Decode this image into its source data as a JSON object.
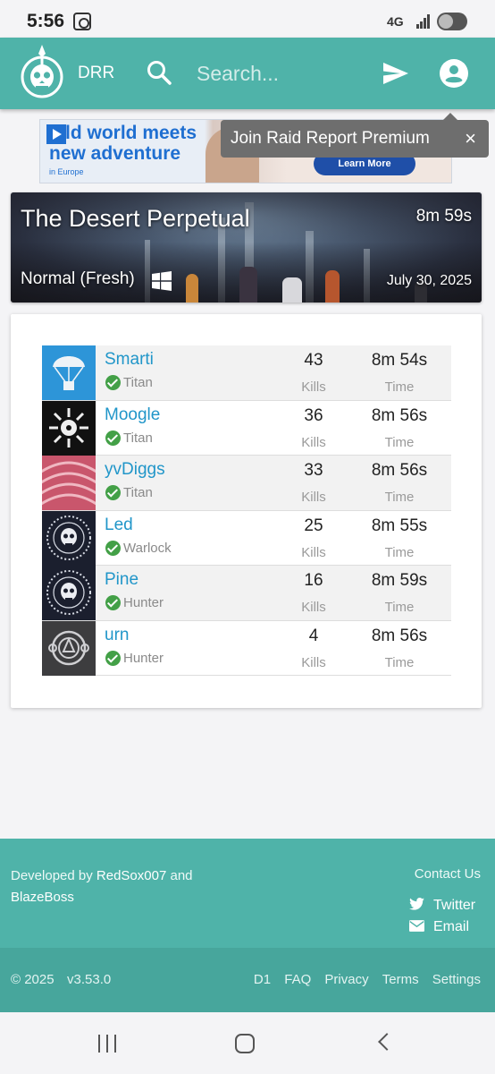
{
  "status_bar": {
    "time": "5:56",
    "network": "4G"
  },
  "app_bar": {
    "brand": "DRR",
    "search_placeholder": "Search..."
  },
  "ad": {
    "headline": "ld world meets new adventure",
    "subtext": "in Europe",
    "cta": "Learn More"
  },
  "tooltip": {
    "text": "Join Raid Report Premium",
    "close": "×"
  },
  "activity": {
    "title": "The Desert Perpetual",
    "duration": "8m 59s",
    "mode": "Normal (Fresh)",
    "date": "July 30, 2025"
  },
  "roster": {
    "kills_label": "Kills",
    "time_label": "Time",
    "players": [
      {
        "name": "Smarti",
        "class": "Titan",
        "kills": "43",
        "time": "8m 54s"
      },
      {
        "name": "Moogle",
        "class": "Titan",
        "kills": "36",
        "time": "8m 56s"
      },
      {
        "name": "yvDiggs",
        "class": "Titan",
        "kills": "33",
        "time": "8m 56s"
      },
      {
        "name": "Led",
        "class": "Warlock",
        "kills": "25",
        "time": "8m 55s"
      },
      {
        "name": "Pine",
        "class": "Hunter",
        "kills": "16",
        "time": "8m 59s"
      },
      {
        "name": "urn",
        "class": "Hunter",
        "kills": "4",
        "time": "8m 56s"
      }
    ]
  },
  "footer": {
    "developed_prefix": "Developed by",
    "dev1": "RedSox007",
    "and": "and",
    "dev2": "BlazeBoss",
    "contact": "Contact Us",
    "twitter": "Twitter",
    "email": "Email",
    "copyright": "© 2025",
    "version": "v3.53.0",
    "links": [
      "D1",
      "FAQ",
      "Privacy",
      "Terms",
      "Settings"
    ]
  },
  "colors": {
    "accent": "#4fb3a9",
    "link": "#2196c9",
    "verified": "#43a047"
  }
}
